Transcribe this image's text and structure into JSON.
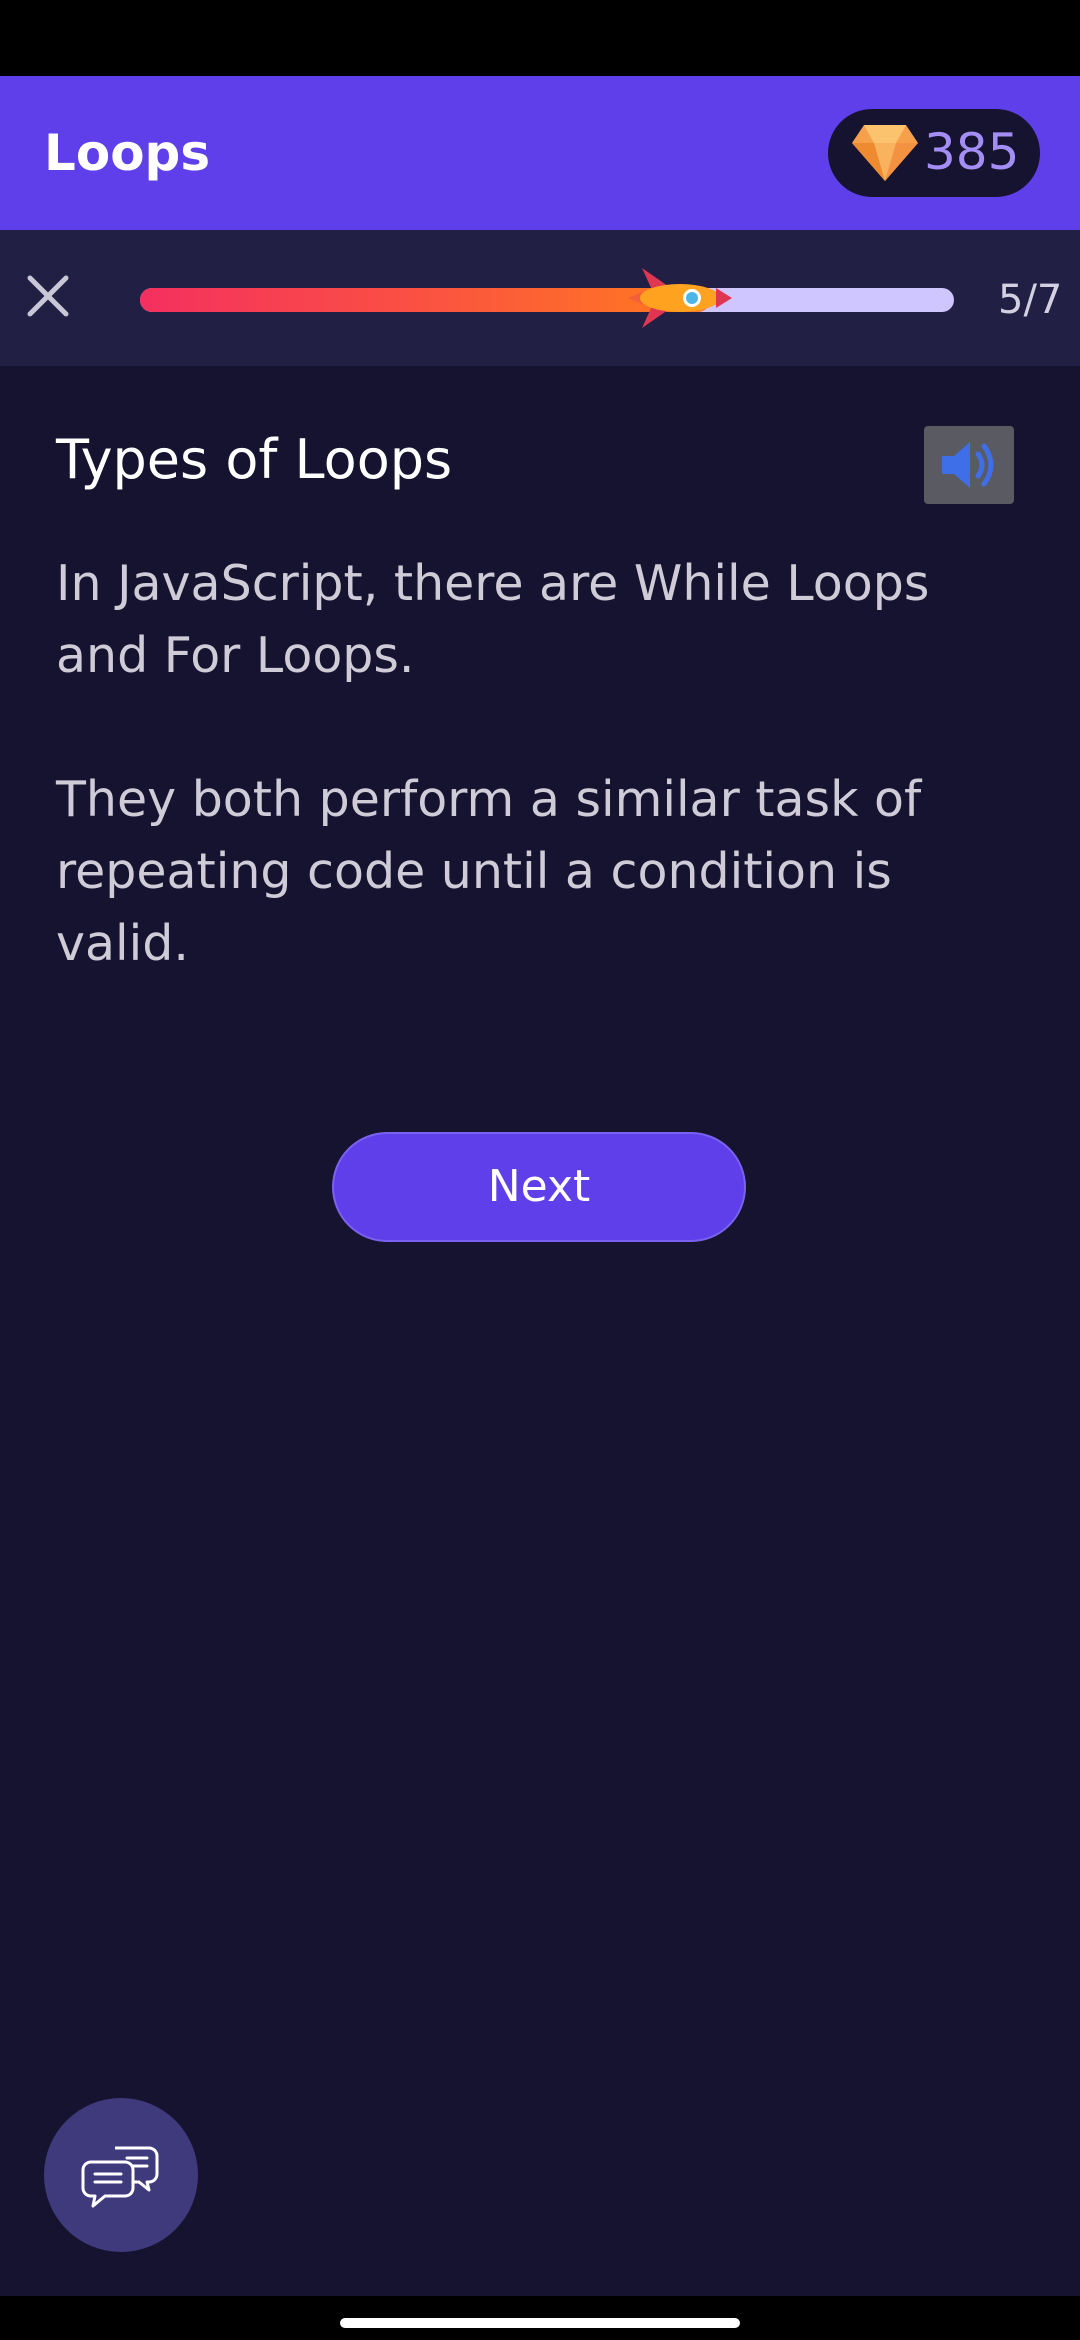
{
  "app_bar": {
    "title": "Loops",
    "gems": {
      "icon": "diamond-icon",
      "count": "385"
    }
  },
  "progress": {
    "close_icon": "close-icon",
    "indicator_icon": "rocket-icon",
    "fraction": 0.7,
    "step_text": "5/7"
  },
  "lesson": {
    "title": "Types of Loops",
    "sound_icon": "speaker-icon",
    "paragraphs": [
      "In JavaScript, there are While Loops and For Loops.",
      "They both perform a similar task of repeating code until a condition is valid."
    ],
    "next_label": "Next"
  },
  "chat": {
    "icon": "chat-bubbles-icon"
  },
  "colors": {
    "accent": "#5f3fe9",
    "background": "#161330",
    "progress_track": "#cfc5ff",
    "progress_start": "#f4305f",
    "progress_end": "#ff7b1e",
    "gem_count": "#a48ef5"
  }
}
